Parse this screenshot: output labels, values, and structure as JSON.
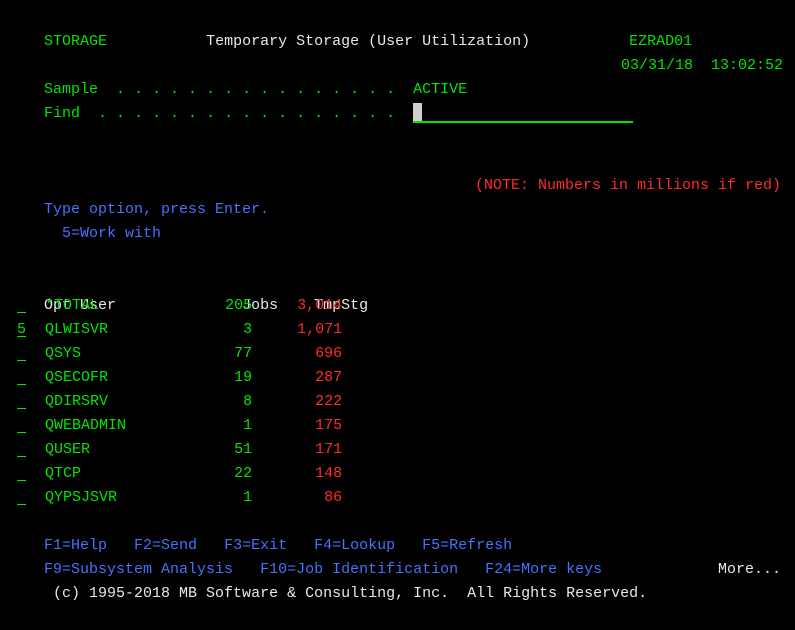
{
  "header": {
    "program": "STORAGE",
    "title": "Temporary Storage (User Utilization)",
    "system": "EZRAD01",
    "date": "03/31/18",
    "time": "13:02:52"
  },
  "sample": {
    "label": "Sample",
    "dots": ". . . . . . . . . . . . . . . .",
    "value": "ACTIVE"
  },
  "find": {
    "label": "Find",
    "dots": ". . . . . . . . . . . . . . . . ."
  },
  "note": "(NOTE: Numbers in millions if red)",
  "instructions": {
    "line1": "Type option, press Enter.",
    "line2": "5=Work with"
  },
  "columns": {
    "opt": "Opt",
    "user": "User",
    "jobs": "Jobs",
    "tmpstg": "TmpStg"
  },
  "rows": [
    {
      "opt": "",
      "user": "*TOTAL",
      "jobs": "205",
      "tmpstg": "3,014"
    },
    {
      "opt": "5",
      "user": "QLWISVR",
      "jobs": "3",
      "tmpstg": "1,071"
    },
    {
      "opt": "",
      "user": "QSYS",
      "jobs": "77",
      "tmpstg": "696"
    },
    {
      "opt": "",
      "user": "QSECOFR",
      "jobs": "19",
      "tmpstg": "287"
    },
    {
      "opt": "",
      "user": "QDIRSRV",
      "jobs": "8",
      "tmpstg": "222"
    },
    {
      "opt": "",
      "user": "QWEBADMIN",
      "jobs": "1",
      "tmpstg": "175"
    },
    {
      "opt": "",
      "user": "QUSER",
      "jobs": "51",
      "tmpstg": "171"
    },
    {
      "opt": "",
      "user": "QTCP",
      "jobs": "22",
      "tmpstg": "148"
    },
    {
      "opt": "",
      "user": "QYPSJSVR",
      "jobs": "1",
      "tmpstg": "86"
    }
  ],
  "fkeys": {
    "row1": [
      "F1=Help",
      "F2=Send",
      "F3=Exit",
      "F4=Lookup",
      "F5=Refresh"
    ],
    "row2": [
      "F9=Subsystem Analysis",
      "F10=Job Identification",
      "F24=More keys"
    ],
    "more": "More..."
  },
  "copyright": "(c) 1995-2018 MB Software & Consulting, Inc.  All Rights Reserved."
}
